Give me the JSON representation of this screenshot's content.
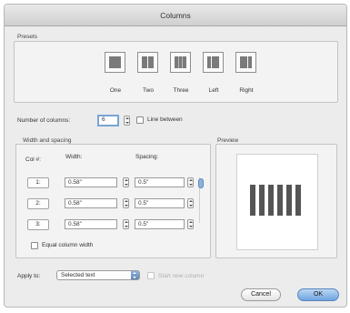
{
  "window": {
    "title": "Columns"
  },
  "presets": {
    "title": "Presets",
    "items": [
      {
        "label": "One",
        "icon": "one-column-icon"
      },
      {
        "label": "Two",
        "icon": "two-columns-icon"
      },
      {
        "label": "Three",
        "icon": "three-columns-icon"
      },
      {
        "label": "Left",
        "icon": "left-columns-icon"
      },
      {
        "label": "Right",
        "icon": "right-columns-icon"
      }
    ]
  },
  "number_of_columns": {
    "label": "Number of columns:",
    "value": "6"
  },
  "line_between": {
    "label": "Line between",
    "checked": false
  },
  "width_spacing": {
    "title": "Width and spacing",
    "col_header": "Col #:",
    "width_header": "Width:",
    "spacing_header": "Spacing:",
    "rows": [
      {
        "col": "1:",
        "width": "0.58\"",
        "spacing": "0.5\""
      },
      {
        "col": "2:",
        "width": "0.58\"",
        "spacing": "0.5\""
      },
      {
        "col": "3:",
        "width": "0.58\"",
        "spacing": "0.5\""
      }
    ],
    "equal_width_label": "Equal column width",
    "equal_width_checked": false
  },
  "preview": {
    "title": "Preview",
    "columns": 6
  },
  "apply_to": {
    "label": "Apply to:",
    "value": "Selected text"
  },
  "start_new_column": {
    "label": "Start new column",
    "enabled": false
  },
  "buttons": {
    "cancel": "Cancel",
    "ok": "OK"
  },
  "colors": {
    "accent": "#6ea4e0",
    "focus_ring": "#78a5d6"
  }
}
